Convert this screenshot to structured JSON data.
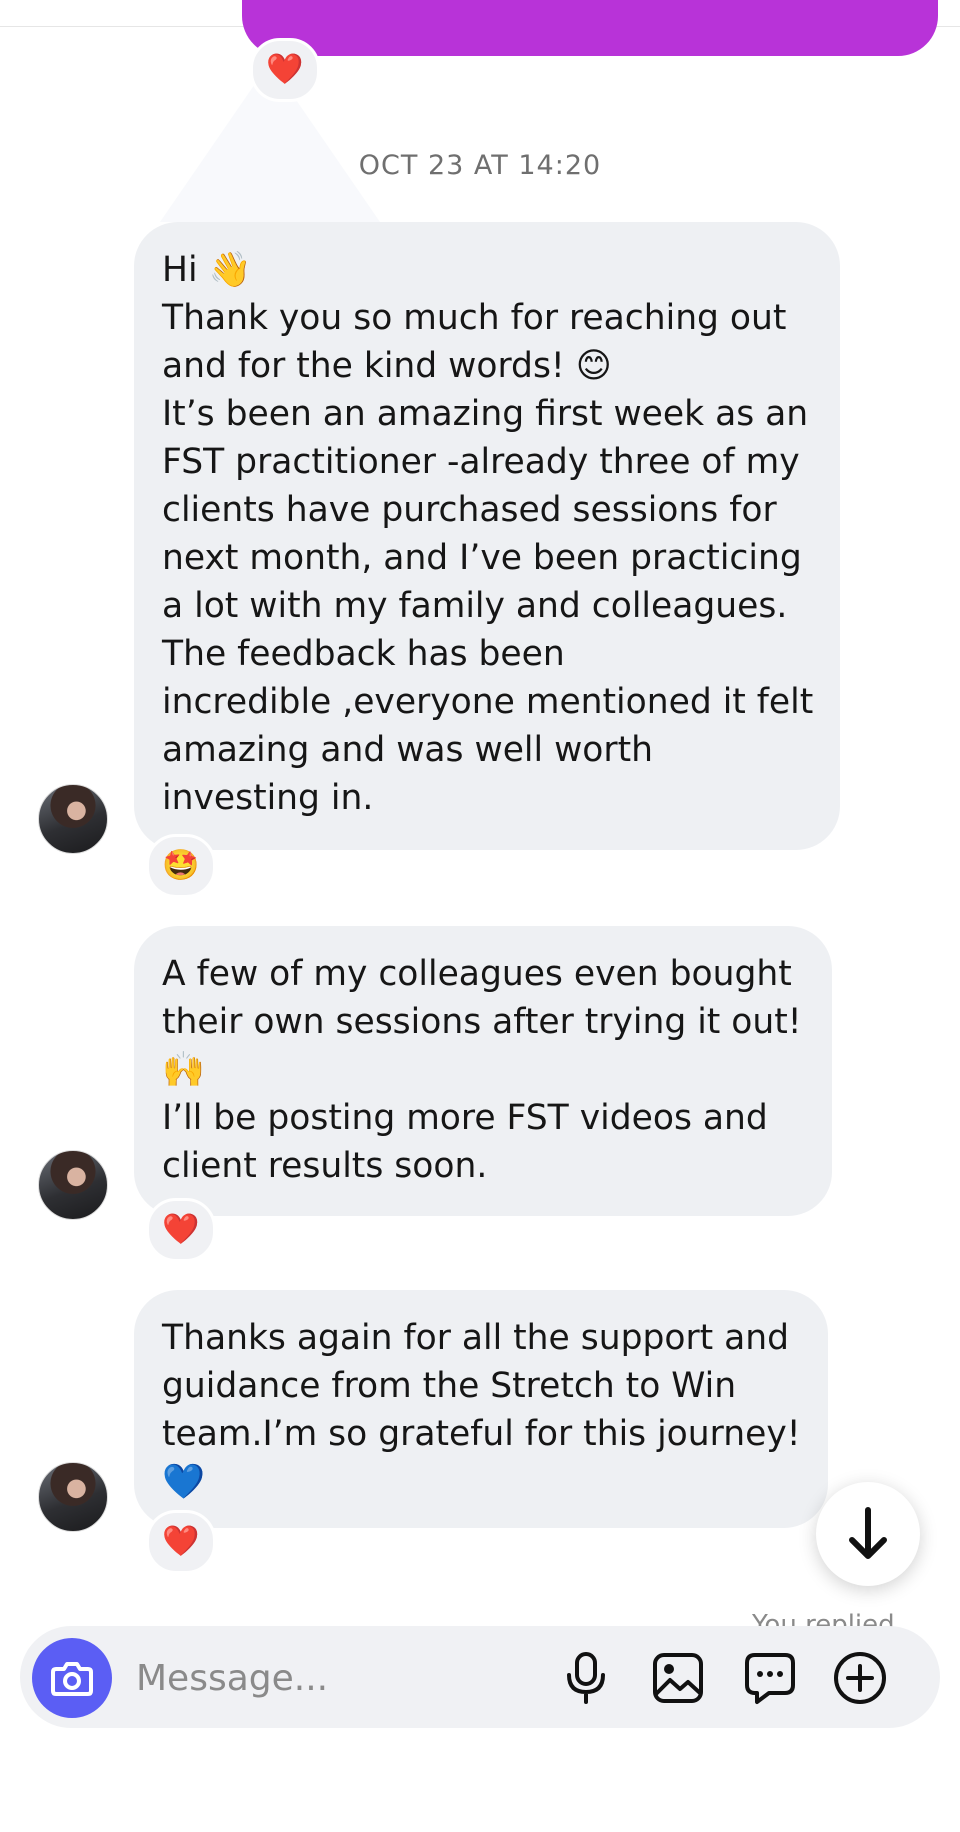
{
  "thread": {
    "previous_sent_reaction": "❤️",
    "timestamp": "OCT 23 AT 14:20",
    "messages": [
      {
        "lines": [
          "Hi 👋",
          "Thank you so much for reaching out",
          "and for the kind words! 😊",
          "It’s been an amazing first week as an",
          "FST practitioner -already three of my",
          "clients have purchased sessions for",
          "next month, and I’ve been practicing",
          "a lot with my family and colleagues.",
          "The feedback has been",
          "incredible ,everyone mentioned it felt",
          "amazing and was well worth",
          "investing in."
        ],
        "reaction": "🤩"
      },
      {
        "lines": [
          "A few of my colleagues even bought",
          "their own sessions after trying it out!",
          "🙌",
          "I’ll be posting more FST videos and",
          "client results soon."
        ],
        "reaction": "❤️"
      },
      {
        "lines": [
          "Thanks again for all the support and",
          "guidance from the Stretch to Win",
          "team.I’m so grateful for this journey!",
          "💙"
        ],
        "reaction": "❤️"
      }
    ],
    "you_replied": "You replied"
  },
  "composer": {
    "placeholder": "Message..."
  },
  "colors": {
    "sent_bubble": "#b833d8",
    "received_bubble": "#eef0f3",
    "camera_button": "#5b5ef4"
  },
  "icons": [
    "camera-icon",
    "microphone-icon",
    "gallery-icon",
    "sticker-chat-icon",
    "plus-circle-icon",
    "arrow-down-icon"
  ]
}
